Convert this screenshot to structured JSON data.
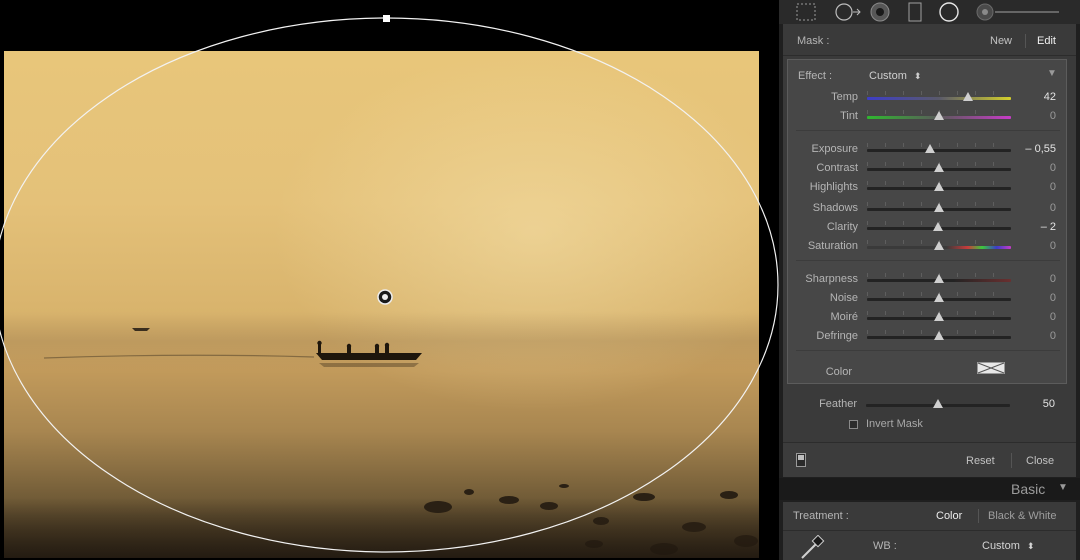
{
  "tools": {
    "icons": [
      "crop-overlay-icon",
      "spot-removal-icon",
      "red-eye-icon",
      "graduated-filter-icon",
      "radial-filter-icon",
      "adjustment-brush-icon"
    ]
  },
  "mask": {
    "label": "Mask :",
    "new_label": "New",
    "edit_label": "Edit"
  },
  "effect": {
    "label": "Effect :",
    "preset": "Custom",
    "preset_arrows": "⬍",
    "collapse": "▼"
  },
  "sliders": [
    {
      "id": "temp",
      "name": "Temp",
      "value": "42",
      "position": 0.7,
      "strong": true
    },
    {
      "id": "tint",
      "name": "Tint",
      "value": "0",
      "position": 0.5,
      "strong": false
    },
    {
      "id": "exposure",
      "name": "Exposure",
      "value": "– 0,55",
      "position": 0.44,
      "strong": true
    },
    {
      "id": "contrast",
      "name": "Contrast",
      "value": "0",
      "position": 0.5,
      "strong": false
    },
    {
      "id": "highlights",
      "name": "Highlights",
      "value": "0",
      "position": 0.5,
      "strong": false
    },
    {
      "id": "shadows",
      "name": "Shadows",
      "value": "0",
      "position": 0.5,
      "strong": false
    },
    {
      "id": "clarity",
      "name": "Clarity",
      "value": "– 2",
      "position": 0.49,
      "strong": true
    },
    {
      "id": "saturation",
      "name": "Saturation",
      "value": "0",
      "position": 0.5,
      "strong": false
    },
    {
      "id": "sharpness",
      "name": "Sharpness",
      "value": "0",
      "position": 0.5,
      "strong": false
    },
    {
      "id": "noise",
      "name": "Noise",
      "value": "0",
      "position": 0.5,
      "strong": false
    },
    {
      "id": "moire",
      "name": "Moiré",
      "value": "0",
      "position": 0.5,
      "strong": false
    },
    {
      "id": "defringe",
      "name": "Defringe",
      "value": "0",
      "position": 0.5,
      "strong": false
    }
  ],
  "color": {
    "label": "Color"
  },
  "feather": {
    "name": "Feather",
    "value": "50",
    "position": 0.5
  },
  "invert_mask": {
    "label": "Invert Mask",
    "checked": false
  },
  "footer": {
    "reset_label": "Reset",
    "close_label": "Close"
  },
  "basic": {
    "title": "Basic",
    "collapse": "▼",
    "treatment_label": "Treatment :",
    "color_option": "Color",
    "bw_option": "Black & White",
    "wb_label": "WB :",
    "wb_value": "Custom",
    "wb_arrows": "⬍"
  },
  "colors": {
    "panel_bg": "#3a3a3a",
    "effect_bg": "#474747",
    "temp_left": "#3d3dc8",
    "temp_right": "#d4d02c",
    "tint_left": "#2fb82f",
    "tint_right": "#c83cc8"
  }
}
